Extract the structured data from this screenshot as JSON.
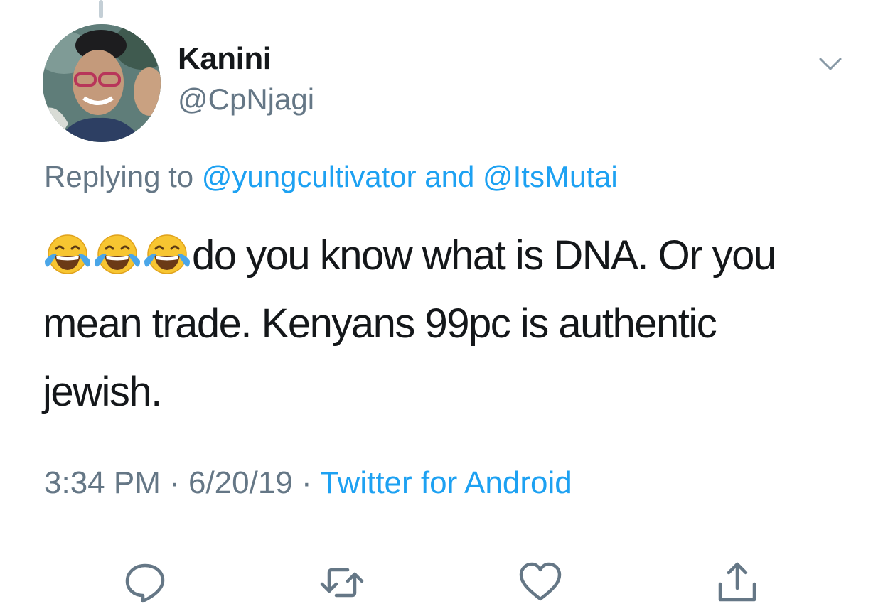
{
  "author": {
    "display_name": "Kanini",
    "handle": "@CpNjagi"
  },
  "reply": {
    "prefix": "Replying to ",
    "mention_1": "@yungcultivator",
    "conjunction": " and ",
    "mention_2": "@ItsMutai"
  },
  "tweet": {
    "emoji_name": "face-with-tears-of-joy",
    "emoji_count": 3,
    "text": "do you know what is DNA. Or you mean trade. Kenyans 99pc is authentic jewish."
  },
  "meta": {
    "time": "3:34 PM",
    "separator": " · ",
    "date": "6/20/19",
    "source": "Twitter for Android"
  },
  "actions": [
    "reply-icon",
    "retweet-icon",
    "like-icon",
    "share-icon"
  ],
  "colors": {
    "link": "#1da1f2",
    "secondary_text": "#657786",
    "primary_text": "#14171a",
    "icon": "#657786"
  }
}
